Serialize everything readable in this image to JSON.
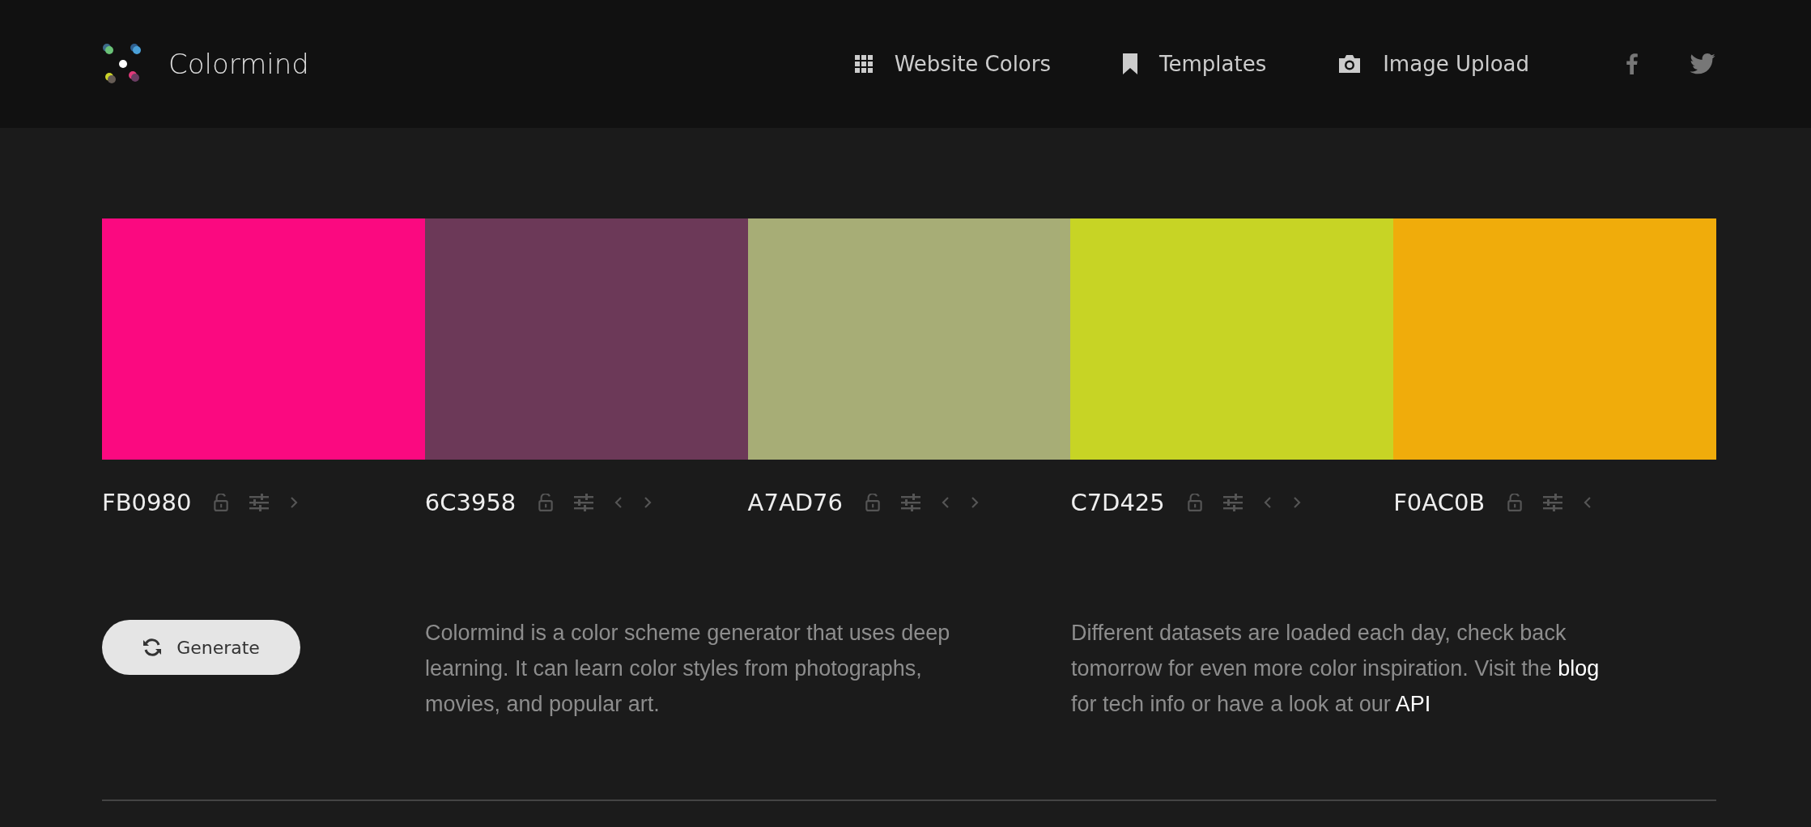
{
  "brand": {
    "name": "Colormind"
  },
  "nav": [
    {
      "label": "Website Colors",
      "kind": "grid"
    },
    {
      "label": "Templates",
      "kind": "bookmark"
    },
    {
      "label": "Image Upload",
      "kind": "camera"
    }
  ],
  "social": [
    {
      "kind": "facebook"
    },
    {
      "kind": "twitter"
    }
  ],
  "swatches": [
    {
      "hex": "FB0980",
      "color": "#fb0980",
      "move_left": false,
      "move_right": true
    },
    {
      "hex": "6C3958",
      "color": "#6c3958",
      "move_left": true,
      "move_right": true
    },
    {
      "hex": "A7AD76",
      "color": "#a7ad76",
      "move_left": true,
      "move_right": true
    },
    {
      "hex": "C7D425",
      "color": "#c7d425",
      "move_left": true,
      "move_right": true
    },
    {
      "hex": "F0AC0B",
      "color": "#f0ac0b",
      "move_left": true,
      "move_right": false
    }
  ],
  "generate_button": {
    "label": "Generate"
  },
  "about": "Colormind is a color scheme generator that uses deep learning. It can learn color styles from photographs, movies, and popular art.",
  "info": [
    {
      "kind": "text",
      "text": "Different datasets are loaded each day, check back tomorrow for even more color inspiration. Visit the "
    },
    {
      "kind": "link",
      "text": "blog"
    },
    {
      "kind": "text",
      "text": " for tech info or have a look at our "
    },
    {
      "kind": "link",
      "text": "API"
    }
  ]
}
